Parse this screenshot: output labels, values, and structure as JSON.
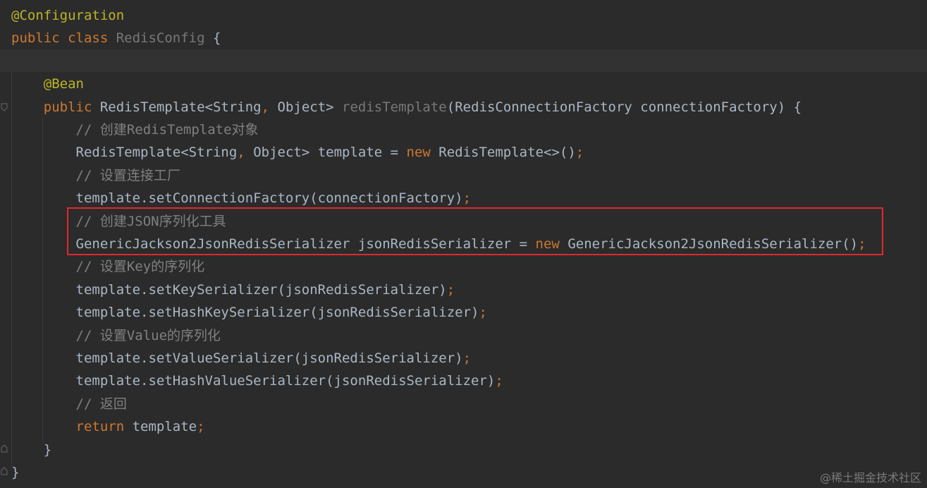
{
  "editor": {
    "current_line_highlight": "#323232",
    "lines": [
      {
        "segments": [
          {
            "t": "@Configuration",
            "c": "ann"
          }
        ]
      },
      {
        "segments": [
          {
            "t": "public ",
            "c": "kw"
          },
          {
            "t": "class ",
            "c": "kw"
          },
          {
            "t": "RedisConfig",
            "c": "unused"
          },
          {
            "t": " {",
            "c": "cls"
          }
        ]
      },
      {
        "segments": []
      },
      {
        "segments": [
          {
            "t": "    ",
            "c": "cls"
          },
          {
            "t": "@Bean",
            "c": "ann"
          }
        ]
      },
      {
        "segments": [
          {
            "t": "    ",
            "c": "cls"
          },
          {
            "t": "public ",
            "c": "kw"
          },
          {
            "t": "RedisTemplate<String",
            "c": "cls"
          },
          {
            "t": ", ",
            "c": "pn"
          },
          {
            "t": "Object> ",
            "c": "cls"
          },
          {
            "t": "redisTemplate",
            "c": "unused"
          },
          {
            "t": "(RedisConnectionFactory connectionFactory) {",
            "c": "cls"
          }
        ]
      },
      {
        "segments": [
          {
            "t": "        ",
            "c": "cls"
          },
          {
            "t": "// 创建RedisTemplate对象",
            "c": "cm"
          }
        ]
      },
      {
        "segments": [
          {
            "t": "        RedisTemplate<String",
            "c": "cls"
          },
          {
            "t": ", ",
            "c": "pn"
          },
          {
            "t": "Object> template = ",
            "c": "cls"
          },
          {
            "t": "new ",
            "c": "kw"
          },
          {
            "t": "RedisTemplate<>()",
            "c": "cls"
          },
          {
            "t": ";",
            "c": "pn"
          }
        ]
      },
      {
        "segments": [
          {
            "t": "        ",
            "c": "cls"
          },
          {
            "t": "// 设置连接工厂",
            "c": "cm"
          }
        ]
      },
      {
        "segments": [
          {
            "t": "        template.setConnectionFactory(connectionFactory)",
            "c": "cls"
          },
          {
            "t": ";",
            "c": "pn"
          }
        ]
      },
      {
        "segments": [
          {
            "t": "        ",
            "c": "cls"
          },
          {
            "t": "// 创建JSON序列化工具",
            "c": "cm"
          }
        ]
      },
      {
        "segments": [
          {
            "t": "        GenericJackson2JsonRedisSerializer jsonRedisSerializer = ",
            "c": "cls"
          },
          {
            "t": "new ",
            "c": "kw"
          },
          {
            "t": "GenericJackson2JsonRedisSerializer()",
            "c": "cls"
          },
          {
            "t": ";",
            "c": "pn"
          }
        ]
      },
      {
        "segments": [
          {
            "t": "        ",
            "c": "cls"
          },
          {
            "t": "// 设置Key的序列化",
            "c": "cm"
          }
        ]
      },
      {
        "segments": [
          {
            "t": "        template.setKeySerializer(jsonRedisSerializer)",
            "c": "cls"
          },
          {
            "t": ";",
            "c": "pn"
          }
        ]
      },
      {
        "segments": [
          {
            "t": "        template.setHashKeySerializer(jsonRedisSerializer)",
            "c": "cls"
          },
          {
            "t": ";",
            "c": "pn"
          }
        ]
      },
      {
        "segments": [
          {
            "t": "        ",
            "c": "cls"
          },
          {
            "t": "// 设置Value的序列化",
            "c": "cm"
          }
        ]
      },
      {
        "segments": [
          {
            "t": "        template.setValueSerializer(jsonRedisSerializer)",
            "c": "cls"
          },
          {
            "t": ";",
            "c": "pn"
          }
        ]
      },
      {
        "segments": [
          {
            "t": "        template.setHashValueSerializer(jsonRedisSerializer)",
            "c": "cls"
          },
          {
            "t": ";",
            "c": "pn"
          }
        ]
      },
      {
        "segments": [
          {
            "t": "        ",
            "c": "cls"
          },
          {
            "t": "// 返回",
            "c": "cm"
          }
        ]
      },
      {
        "segments": [
          {
            "t": "        ",
            "c": "cls"
          },
          {
            "t": "return ",
            "c": "kw"
          },
          {
            "t": "template",
            "c": "cls"
          },
          {
            "t": ";",
            "c": "pn"
          }
        ]
      },
      {
        "segments": [
          {
            "t": "    }",
            "c": "cls"
          }
        ]
      },
      {
        "segments": [
          {
            "t": "}",
            "c": "cls"
          }
        ]
      }
    ]
  },
  "highlight": {
    "color": "#e0282e"
  },
  "watermark": {
    "text": "@稀土掘金技术社区"
  },
  "colors": {
    "background": "#2b2b2b",
    "annotation": "#bbb529",
    "keyword": "#cc7832",
    "text": "#a9b7c6",
    "comment": "#808080"
  }
}
